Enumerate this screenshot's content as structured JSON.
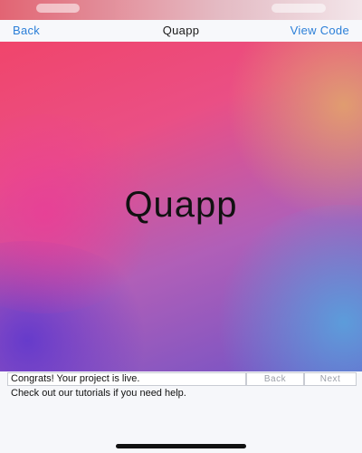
{
  "navbar": {
    "back_label": "Back",
    "title": "Quapp",
    "view_code_label": "View Code"
  },
  "hero": {
    "title": "Quapp"
  },
  "tutorial": {
    "message_line_1": "Congrats! Your project is live.",
    "message_line_2": "Check out our tutorials if you need help.",
    "back_label": "Back",
    "next_label": "Next"
  },
  "colors": {
    "accent": "#2b7fd8",
    "gradient_pink": "#f0456b",
    "gradient_purple": "#6f52c6",
    "gradient_orange": "#e1a06e",
    "gradient_blue": "#5aa0dc"
  },
  "icons": {
    "home_indicator": "home-indicator-bar"
  }
}
